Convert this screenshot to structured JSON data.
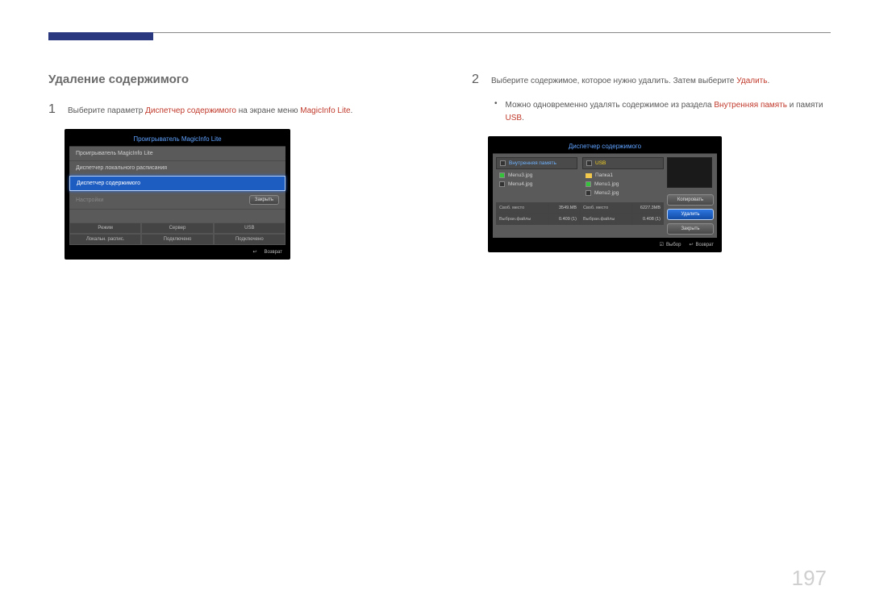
{
  "page_number": "197",
  "section_title": "Удаление содержимого",
  "step1": {
    "num": "1",
    "text_pre": "Выберите параметр ",
    "text_red1": "Диспетчер содержимого",
    "text_mid": " на экране меню ",
    "text_red2": "MagicInfo Lite",
    "text_post": "."
  },
  "step2": {
    "num": "2",
    "text_pre": "Выберите содержимое, которое нужно удалить. Затем выберите ",
    "text_red": "Удалить",
    "text_post": "."
  },
  "bullet2": {
    "text_pre": "Можно одновременно удалять содержимое из раздела ",
    "text_red1": "Внутренняя память",
    "text_mid": " и памяти ",
    "text_red2": "USB",
    "text_post": "."
  },
  "shot1": {
    "title": "Проигрыватель MagicInfo Lite",
    "items": {
      "a": "Проигрыватель MagicInfo Lite",
      "b": "Диспетчер локального расписания",
      "c": "Диспетчер содержимого",
      "d": "Настройки"
    },
    "close": "Закрыть",
    "info": {
      "mode_h": "Режим",
      "server_h": "Сервер",
      "usb_h": "USB",
      "mode_v": "Локальн. распис.",
      "server_v": "Подключено",
      "usb_v": "Подключено"
    },
    "return_label": "Возврат"
  },
  "shot2": {
    "title": "Диспетчер содержимого",
    "col1_title": "Внутренняя память",
    "col2_title": "USB",
    "col1_files": {
      "a": "Menu3.jpg",
      "b": "Menu4.jpg"
    },
    "col2_files": {
      "a": "Папка1",
      "b": "Menu1.jpg",
      "c": "Menu2.jpg"
    },
    "btns": {
      "copy": "Копировать",
      "delete": "Удалить",
      "close": "Закрыть"
    },
    "stats": {
      "free1_l": "Своб. место",
      "free1_v": "3549.MB",
      "free2_l": "Своб. место",
      "free2_v": "6227.3MB",
      "sel1_l": "Выбран.файлы",
      "sel1_v": "0.409 (1)",
      "sel2_l": "Выбран.файлы",
      "sel2_v": "0.408 (1)"
    },
    "select_label": "Выбор",
    "return_label": "Возврат"
  }
}
